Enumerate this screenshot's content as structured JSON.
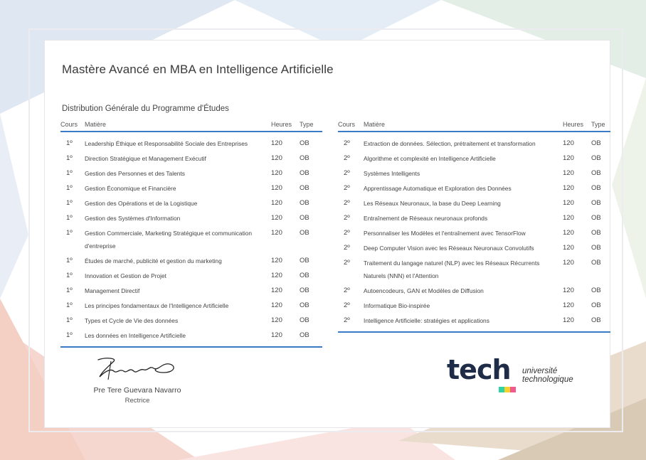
{
  "title": "Mastère Avancé en MBA en Intelligence Artificielle",
  "subtitle": "Distribution Générale du Programme d'Études",
  "headers": {
    "cours": "Cours",
    "matiere": "Matière",
    "heures": "Heures",
    "type": "Type"
  },
  "table_left": [
    {
      "cours": "1º",
      "matiere": "Leadership Éthique et Responsabilité Sociale des Entreprises",
      "heures": "120",
      "type": "OB"
    },
    {
      "cours": "1º",
      "matiere": "Direction Stratégique et Management Exécutif",
      "heures": "120",
      "type": "OB"
    },
    {
      "cours": "1º",
      "matiere": "Gestion des Personnes et des Talents",
      "heures": "120",
      "type": "OB"
    },
    {
      "cours": "1º",
      "matiere": "Gestion Économique et Financière",
      "heures": "120",
      "type": "OB"
    },
    {
      "cours": "1º",
      "matiere": "Gestion des Opérations et de la Logistique",
      "heures": "120",
      "type": "OB"
    },
    {
      "cours": "1º",
      "matiere": "Gestion des Systèmes d'Information",
      "heures": "120",
      "type": "OB"
    },
    {
      "cours": "1º",
      "matiere": "Gestion Commerciale, Marketing Stratégique et communication d'entreprise",
      "heures": "120",
      "type": "OB"
    },
    {
      "cours": "1º",
      "matiere": "Études de marché, publicité et gestion du marketing",
      "heures": "120",
      "type": "OB"
    },
    {
      "cours": "1º",
      "matiere": "Innovation et Gestion de Projet",
      "heures": "120",
      "type": "OB"
    },
    {
      "cours": "1º",
      "matiere": "Management Directif",
      "heures": "120",
      "type": "OB"
    },
    {
      "cours": "1º",
      "matiere": "Les principes fondamentaux de l'Intelligence Artificielle",
      "heures": "120",
      "type": "OB"
    },
    {
      "cours": "1º",
      "matiere": "Types et Cycle de Vie des données",
      "heures": "120",
      "type": "OB"
    },
    {
      "cours": "1º",
      "matiere": "Les données en Intelligence Artificielle",
      "heures": "120",
      "type": "OB"
    }
  ],
  "table_right": [
    {
      "cours": "2º",
      "matiere": "Extraction de données. Sélection, prétraitement et transformation",
      "heures": "120",
      "type": "OB"
    },
    {
      "cours": "2º",
      "matiere": "Algorithme et complexité en Intelligence Artificielle",
      "heures": "120",
      "type": "OB"
    },
    {
      "cours": "2º",
      "matiere": "Systèmes Intelligents",
      "heures": "120",
      "type": "OB"
    },
    {
      "cours": "2º",
      "matiere": "Apprentissage Automatique et Exploration des Données",
      "heures": "120",
      "type": "OB"
    },
    {
      "cours": "2º",
      "matiere": "Les Réseaux Neuronaux, la base du Deep Learning",
      "heures": "120",
      "type": "OB"
    },
    {
      "cours": "2º",
      "matiere": "Entraînement de Réseaux neuronaux profonds",
      "heures": "120",
      "type": "OB"
    },
    {
      "cours": "2º",
      "matiere": "Personnaliser les Modèles et l'entraînement avec TensorFlow",
      "heures": "120",
      "type": "OB"
    },
    {
      "cours": "2º",
      "matiere": "Deep Computer Vision avec les Réseaux Neuronaux Convolutifs",
      "heures": "120",
      "type": "OB"
    },
    {
      "cours": "2º",
      "matiere": "Traitement du langage naturel (NLP) avec les Réseaux Récurrents Naturels (NNN) et l'Attention",
      "heures": "120",
      "type": "OB"
    },
    {
      "cours": "2º",
      "matiere": "Autoencodeurs, GAN et Modèles de Diffusion",
      "heures": "120",
      "type": "OB"
    },
    {
      "cours": "2º",
      "matiere": "Informatique Bio-inspirée",
      "heures": "120",
      "type": "OB"
    },
    {
      "cours": "2º",
      "matiere": "Intelligence Artificielle: stratégies et applications",
      "heures": "120",
      "type": "OB"
    }
  ],
  "signature": {
    "name": "Pre Tere Guevara Navarro",
    "role": "Rectrice"
  },
  "logo": {
    "word": "tech",
    "line1": "université",
    "line2": "technologique"
  },
  "colors": {
    "accent": "#3a7bc8",
    "logo_dark": "#1f2c47",
    "logo_green": "#2fd3a6",
    "logo_yellow": "#f5d32c",
    "logo_pink": "#f05a8c"
  }
}
